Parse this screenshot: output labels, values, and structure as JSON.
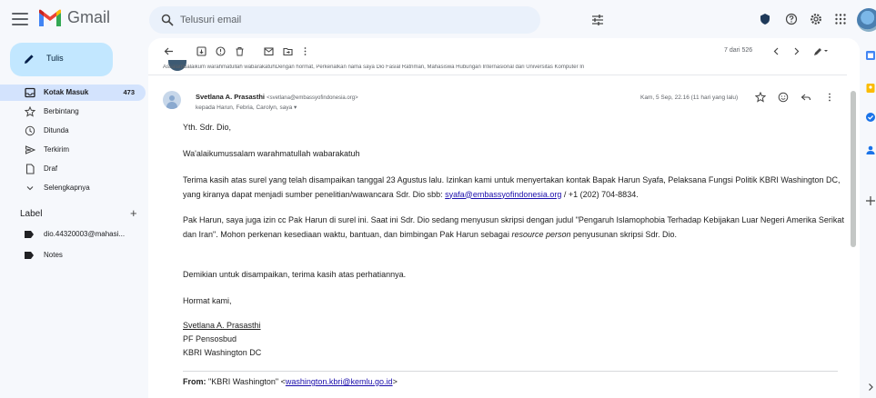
{
  "header": {
    "app_name": "Gmail",
    "search_placeholder": "Telusuri email"
  },
  "sidebar": {
    "compose_label": "Tulis",
    "items": [
      {
        "label": "Kotak Masuk",
        "count": "473",
        "icon": "inbox-icon"
      },
      {
        "label": "Berbintang",
        "count": "",
        "icon": "star-icon"
      },
      {
        "label": "Ditunda",
        "count": "",
        "icon": "clock-icon"
      },
      {
        "label": "Terkirim",
        "count": "",
        "icon": "send-icon"
      },
      {
        "label": "Draf",
        "count": "",
        "icon": "draft-icon"
      },
      {
        "label": "Selengkapnya",
        "count": "",
        "icon": "chevron-down-icon"
      }
    ],
    "labels_heading": "Label",
    "labels": [
      {
        "label": "dio.44320003@mahasi..."
      },
      {
        "label": "Notes"
      }
    ]
  },
  "toolbar": {
    "pager": "7 dari 526"
  },
  "prior_message_preview": "Assalamualaikum warahmatullah wabarakatuhDengan hormat, Perkenalkan nama saya Dio Fasial Ratnman, Mahasiswa Hubungan Internasional dari Universitas Komputer In",
  "message": {
    "sender_name": "Svetlana A. Prasasthi",
    "sender_email": "<svetlana@embassyofindonesia.org>",
    "recipients": "kepada Harun, Febria, Carolyn, saya ▾",
    "date": "Kam, 5 Sep, 22.16 (11 hari yang lalu)",
    "greeting": "Yth. Sdr. Dio,",
    "salam": "Wa'alaikumussalam warahmatullah wabarakatuh",
    "p1_before": "Terima kasih atas surel yang telah disampaikan tanggal 23 Agustus lalu. Izinkan kami untuk menyertakan kontak Bapak Harun Syafa, Pelaksana Fungsi Politik KBRI Washington DC, yang kiranya dapat menjadi sumber penelitian/wawancara Sdr. Dio sbb: ",
    "p1_link": "syafa@embassyofindonesia.org",
    "p1_after": " / +1 (202) 704-8834.",
    "p2_before": "Pak Harun, saya juga izin cc Pak Harun di surel ini. Saat ini Sdr. Dio sedang menyusun skripsi dengan judul \"Pengaruh Islamophobia Terhadap Kebijakan Luar Negeri Amerika Serikat dan Iran\". Mohon perkenan kesediaan waktu, bantuan, dan bimbingan Pak Harun sebagai ",
    "p2_em": "resource person",
    "p2_after": " penyusunan skripsi Sdr. Dio.",
    "p3": "Demikian untuk disampaikan, terima kasih atas perhatiannya.",
    "closing": "Hormat kami,",
    "sig_name": "Svetlana A. Prasasthi",
    "sig_title": "PF Pensosbud",
    "sig_org": "KBRI Washington DC",
    "from_label": "From:",
    "from_name": " \"KBRI Washington\" <",
    "from_email": "washington.kbri@kemlu.go.id",
    "from_close": ">"
  },
  "colors": {
    "accent_compose": "#c2e7ff",
    "active_nav": "#d3e3fd",
    "background": "#f6f8fc",
    "link": "#1a0dab"
  }
}
